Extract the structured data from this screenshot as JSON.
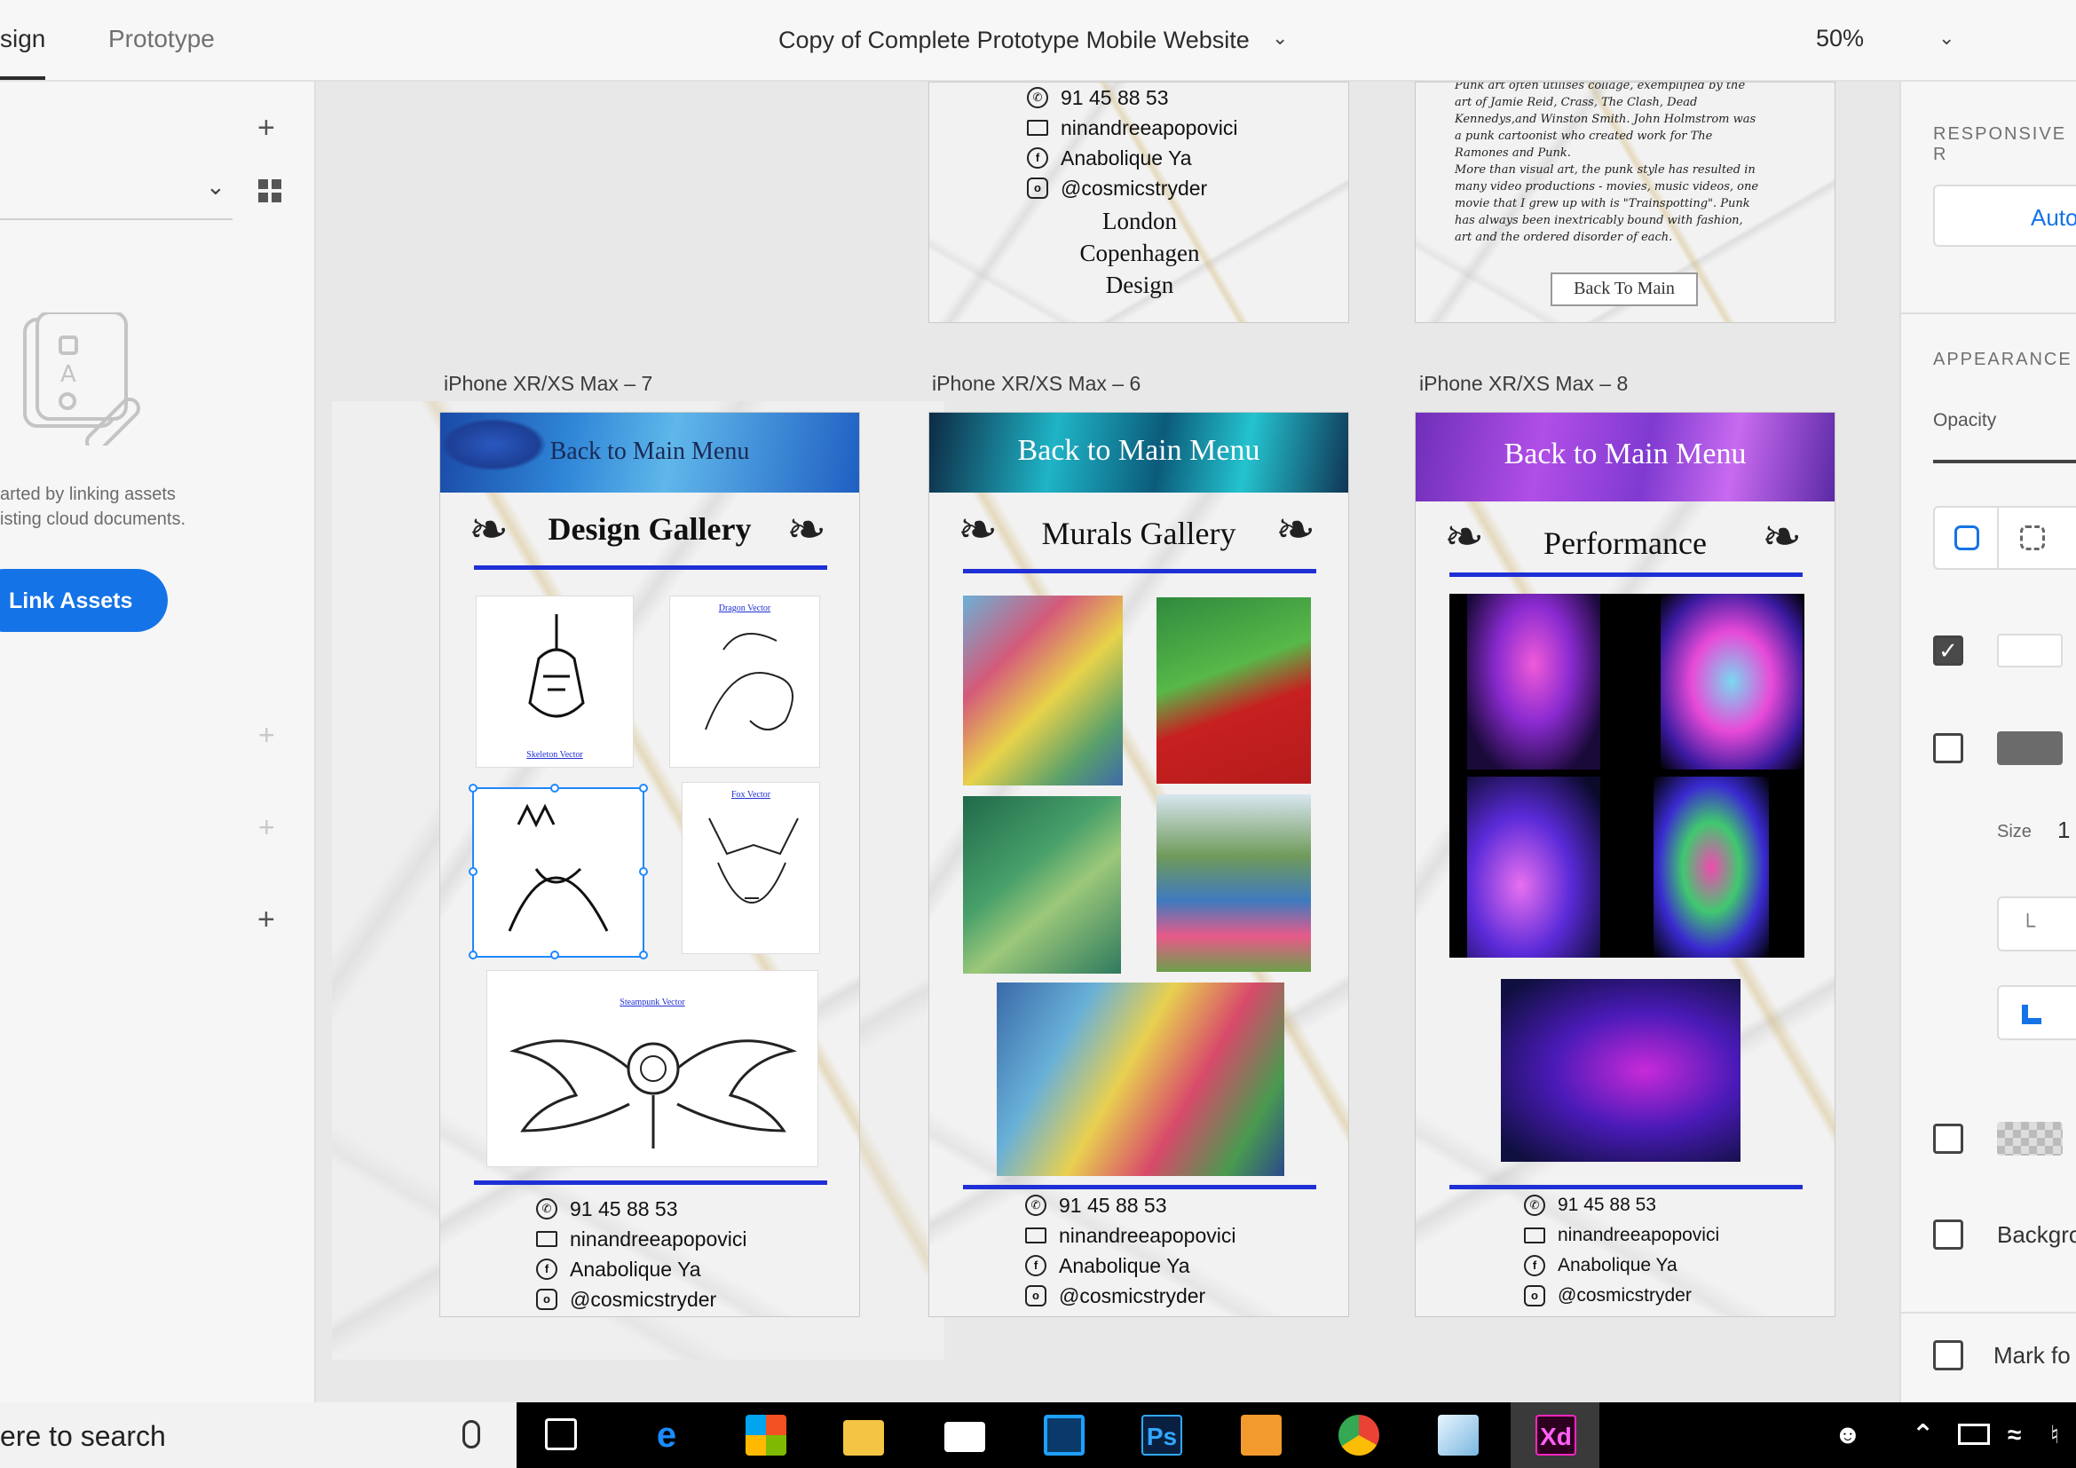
{
  "topbar": {
    "tab_design": "sign",
    "tab_prototype": "Prototype",
    "document_title": "Copy of Complete Prototype Mobile Website",
    "zoom": "50%"
  },
  "left_panel": {
    "description_line1": "arted by linking assets",
    "description_line2": "isting cloud documents.",
    "link_assets_label": "Link Assets"
  },
  "artboards": {
    "ab7": {
      "label": "iPhone XR/XS Max – 7",
      "banner": "Back to Main Menu",
      "title": "Design Gallery",
      "captions": [
        "Skeleton Vector",
        "Dragon Vector",
        "Fox Vector",
        "Steampunk Vector"
      ]
    },
    "ab6": {
      "label": "iPhone XR/XS Max – 6",
      "banner": "Back to Main Menu",
      "title": "Murals Gallery"
    },
    "ab8": {
      "label": "iPhone XR/XS Max – 8",
      "banner": "Back to Main Menu",
      "title": "Performance"
    },
    "top_left": {
      "cities": [
        "London",
        "Copenhagen",
        "Design"
      ]
    },
    "top_right": {
      "body": [
        "Punk art often utilises collage, exemplified by the",
        "art of Jamie Reid, Crass, The Clash, Dead",
        "Kennedys,and Winston Smith. John Holmstrom was",
        "a punk cartoonist who created work for The",
        "Ramones and Punk.",
        "More than visual art, the punk style has resulted in",
        "many video productions - movies, music videos, one",
        "movie that I grew up with is \"Trainspotting\". Punk",
        "has always been inextricably bound with fashion,",
        "art and the ordered disorder of each."
      ],
      "back_button": "Back To Main"
    }
  },
  "contact": {
    "phone": "91 45 88 53",
    "email": "ninandreeapopovici",
    "facebook": "Anabolique Ya",
    "instagram": "@cosmicstryder"
  },
  "right_panel": {
    "responsive_heading": "RESPONSIVE R",
    "auto_label": "Auto",
    "appearance_heading": "APPEARANCE",
    "opacity_label": "Opacity",
    "size_label": "Size",
    "size_value": "1",
    "background_label": "Backgro",
    "mark_label": "Mark fo"
  },
  "taskbar": {
    "search_text": "ere to search",
    "ps_label": "Ps",
    "xd_label": "Xd"
  },
  "colors": {
    "accent": "#1473e6",
    "rule_blue": "#1f2fd6",
    "xd_magenta": "#ff26be"
  }
}
